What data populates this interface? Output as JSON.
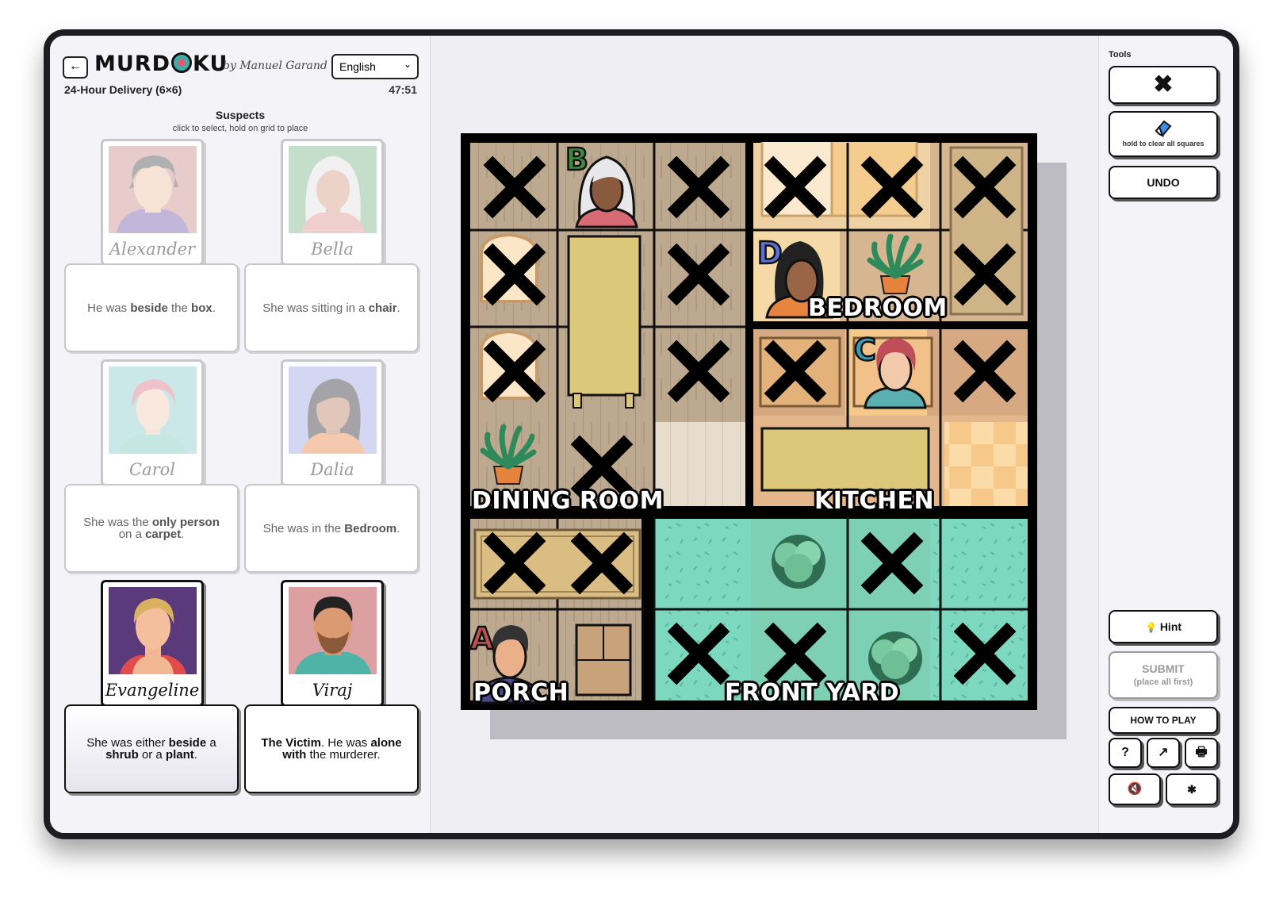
{
  "header": {
    "back_icon": "←",
    "logo": "MURDOKU",
    "byline": "by Manuel Garand",
    "language": "English",
    "puzzle_title": "24-Hour Delivery (6×6)",
    "timer": "47:51"
  },
  "suspects_panel": {
    "title": "Suspects",
    "hint": "click to select, hold on grid to place"
  },
  "suspects": [
    {
      "name": "Alexander",
      "clue_html": "He was <b>beside</b> the <b>box</b>."
    },
    {
      "name": "Bella",
      "clue_html": "She was sitting in a <b>chair</b>."
    },
    {
      "name": "Carol",
      "clue_html": "She was the <b>only person</b> on a <b>carpet</b>."
    },
    {
      "name": "Dalia",
      "clue_html": "She was in the <b>Bedroom</b>."
    },
    {
      "name": "Evangeline",
      "clue_html": "She was either <b>beside</b> a <b>shrub</b> or a <b>plant</b>."
    },
    {
      "name": "Viraj",
      "clue_html": "<b>The Victim</b>. He was <b>alone with</b> the murderer."
    }
  ],
  "board": {
    "rooms": [
      "DINING ROOM",
      "BEDROOM",
      "KITCHEN",
      "PORCH",
      "FRONT YARD"
    ],
    "markers": {
      "A": "A",
      "B": "B",
      "C": "C",
      "D": "D"
    }
  },
  "tools": {
    "label": "Tools",
    "x_icon": "✖",
    "eraser_hint": "hold to clear all squares",
    "undo": "UNDO",
    "hint": "Hint",
    "hint_icon": "💡",
    "submit": "SUBMIT",
    "submit_sub": "(place all first)",
    "how_to_play": "HOW TO PLAY",
    "help_icon": "?",
    "share_icon": "↗",
    "print_icon": "🖶",
    "mute_icon": "🔇",
    "settings_icon": "✱"
  },
  "colors": {
    "frame": "#1c1c22",
    "dining_wood": "#b8a48a",
    "bedroom_floor": "#e9c98a",
    "yard_grass": "#78d6bc",
    "marker_a": "#c0504d",
    "marker_b": "#3e8a3e",
    "marker_c": "#3a9cb8",
    "marker_d": "#5a6fcf"
  }
}
